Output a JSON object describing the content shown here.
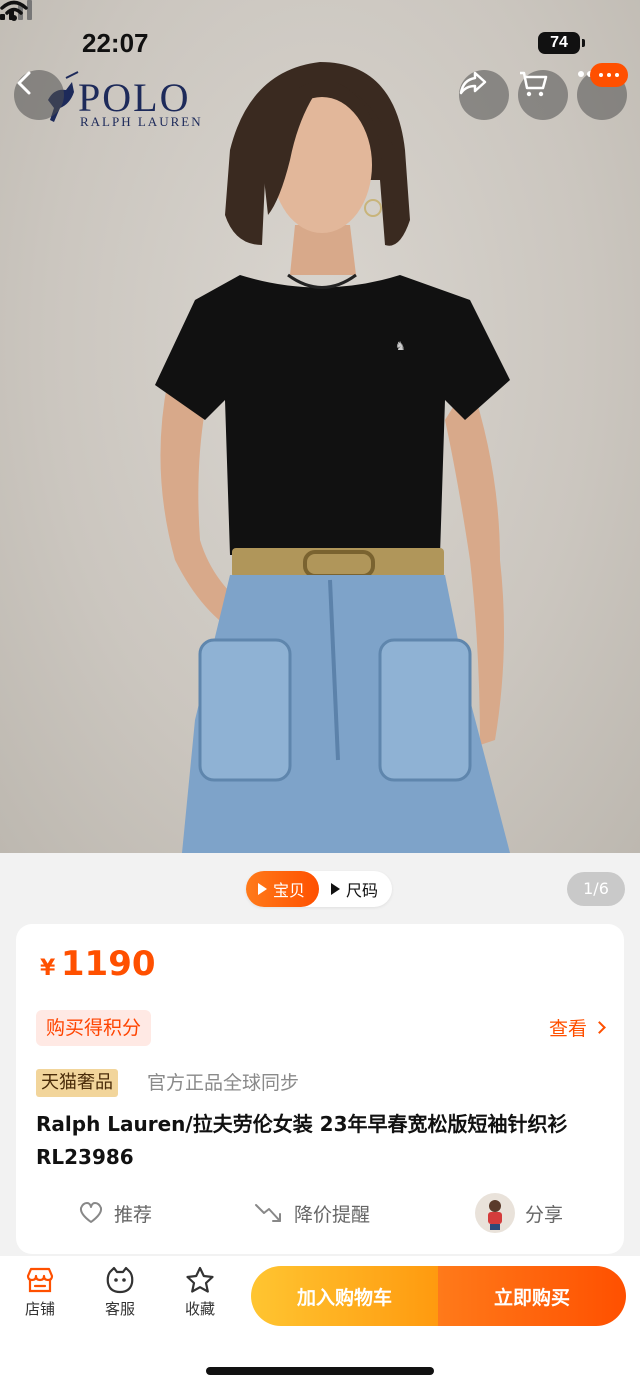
{
  "status_bar": {
    "time": "22:07",
    "battery": "74"
  },
  "brand": {
    "logo_main": "POLO",
    "logo_sub": "RALPH LAUREN"
  },
  "nav": {
    "back_icon": "chevron-left-icon",
    "share_icon": "share-icon",
    "cart_icon": "cart-icon",
    "more_icon": "more-icon"
  },
  "gallery": {
    "tabs": [
      {
        "label": "宝贝",
        "active": true
      },
      {
        "label": "尺码",
        "active": false
      }
    ],
    "counter": "1/6"
  },
  "product": {
    "currency": "¥",
    "price": "1190",
    "points_tag": "购买得积分",
    "view_label": "查看",
    "tmall_badge": "天猫奢品",
    "official_text": "官方正品全球同步",
    "title": "Ralph Lauren/拉夫劳伦女装 23年早春宽松版短袖针织衫RL23986",
    "actions": {
      "recommend": "推荐",
      "price_alert": "降价提醒",
      "share": "分享"
    }
  },
  "bottom_bar": {
    "store": "店铺",
    "service": "客服",
    "favorite": "收藏",
    "add_to_cart": "加入购物车",
    "buy_now": "立即购买"
  },
  "colors": {
    "accent": "#ff5000",
    "cart_gradient_start": "#ffc531",
    "brand_navy": "#1d2a5a"
  }
}
